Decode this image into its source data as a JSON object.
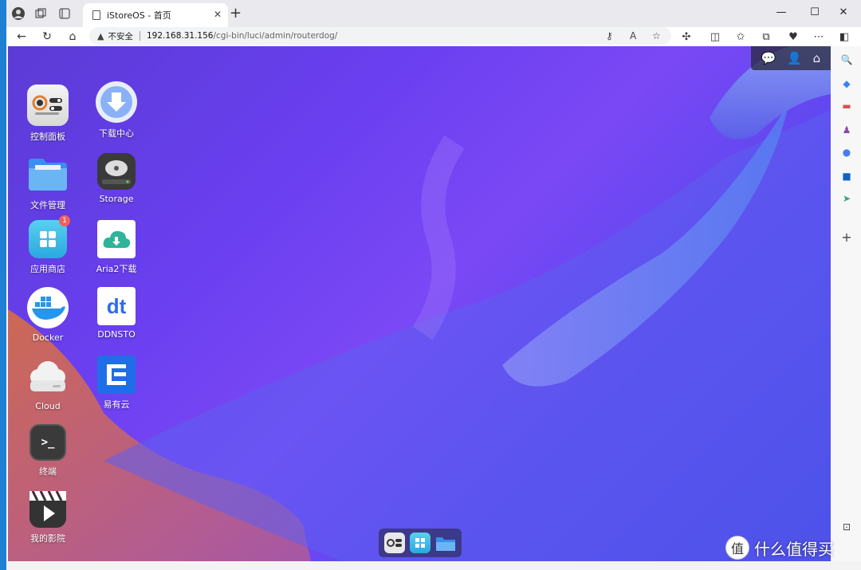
{
  "browser": {
    "tab_title": "iStoreOS - 首页",
    "tab_close": "✕",
    "new_tab": "+",
    "security_label": "不安全",
    "url_host": "192.168.31.156",
    "url_path": "/cgi-bin/luci/admin/routerdog/",
    "window_controls": [
      "—",
      "☐",
      "✕"
    ]
  },
  "desktop": {
    "icons_col1": [
      {
        "label": "控制面板",
        "icon": "control-panel-icon"
      },
      {
        "label": "文件管理",
        "icon": "file-manager-icon"
      },
      {
        "label": "应用商店",
        "icon": "app-store-icon",
        "badge": "1"
      },
      {
        "label": "Docker",
        "icon": "docker-icon"
      },
      {
        "label": "Cloud",
        "icon": "cloud-icon"
      },
      {
        "label": "终端",
        "icon": "terminal-icon"
      },
      {
        "label": "我的影院",
        "icon": "cinema-icon"
      }
    ],
    "icons_col2": [
      {
        "label": "下载中心",
        "icon": "download-center-icon"
      },
      {
        "label": "Storage",
        "icon": "storage-icon"
      },
      {
        "label": "Aria2下载",
        "icon": "aria2-icon"
      },
      {
        "label": "DDNSTO",
        "icon": "ddnsto-icon"
      },
      {
        "label": "易有云",
        "icon": "linkease-icon"
      }
    ],
    "ddnsto_glyph": "dt",
    "terminal_glyph": ">_"
  },
  "watermark": {
    "text": "什么值得买",
    "logo": "值"
  },
  "colors": {
    "accent": "#6a3ff0",
    "badge": "#f25f5c"
  }
}
